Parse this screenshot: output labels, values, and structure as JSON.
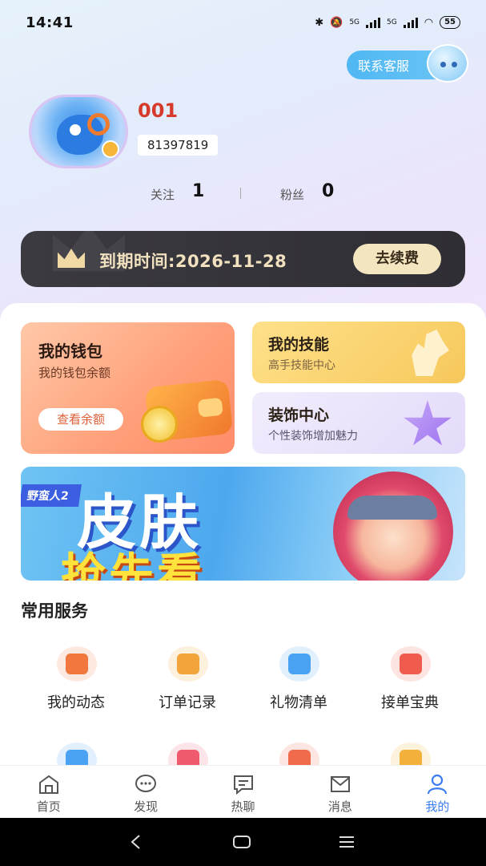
{
  "status_bar": {
    "time": "14:41",
    "signal_1": "5G",
    "signal_2": "5G",
    "battery": "55"
  },
  "customer_service": {
    "label": "联系客服"
  },
  "profile": {
    "username": "001",
    "uid": "81397819",
    "following_label": "关注",
    "following_count": "1",
    "followers_label": "粉丝",
    "followers_count": "0"
  },
  "vip": {
    "expiry_text": "到期时间:2026-11-28",
    "renew_label": "去续费"
  },
  "cards": {
    "wallet": {
      "title": "我的钱包",
      "subtitle": "我的钱包余额",
      "button": "查看余额"
    },
    "skill": {
      "title": "我的技能",
      "subtitle": "高手技能中心"
    },
    "decoration": {
      "title": "装饰中心",
      "subtitle": "个性装饰增加魅力"
    }
  },
  "banner": {
    "tag": "野蛮人2",
    "line1": "皮肤",
    "line2": "抢先看"
  },
  "services": {
    "title": "常用服务",
    "items": [
      {
        "label": "我的动态",
        "icon": "megaphone-icon",
        "color": "#f2773f"
      },
      {
        "label": "订单记录",
        "icon": "order-record-icon",
        "color": "#f3a43a"
      },
      {
        "label": "礼物清单",
        "icon": "gift-icon",
        "color": "#4aa3f2"
      },
      {
        "label": "接单宝典",
        "icon": "chat-book-icon",
        "color": "#ef5b4c"
      },
      {
        "label": "",
        "icon": "user-transfer-icon",
        "color": "#4aa3f2"
      },
      {
        "label": "",
        "icon": "calendar-icon",
        "color": "#ef5b6c"
      },
      {
        "label": "",
        "icon": "coupon-icon",
        "color": "#ef6b4c"
      },
      {
        "label": "",
        "icon": "help-icon",
        "color": "#f3b03a"
      }
    ]
  },
  "bottom_nav": {
    "items": [
      {
        "label": "首页",
        "icon": "home-icon"
      },
      {
        "label": "发现",
        "icon": "discover-icon"
      },
      {
        "label": "热聊",
        "icon": "hot-chat-icon"
      },
      {
        "label": "消息",
        "icon": "message-icon"
      },
      {
        "label": "我的",
        "icon": "profile-icon",
        "active": true
      }
    ]
  },
  "colors": {
    "accent": "#3b7cf0",
    "username": "#d63a2a",
    "vip_bar": "#333238",
    "vip_text": "#f1e1bf"
  }
}
